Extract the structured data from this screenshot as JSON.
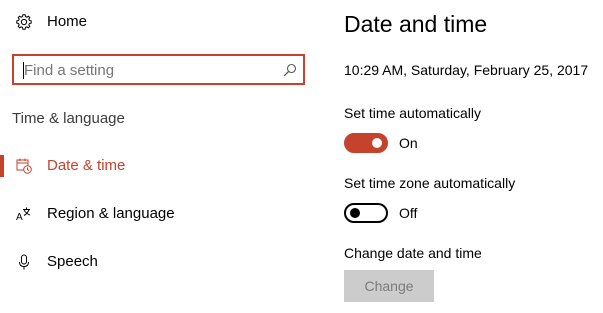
{
  "sidebar": {
    "home": {
      "label": "Home",
      "icon": "gear-icon"
    },
    "search": {
      "placeholder": "Find a setting",
      "value": "",
      "icon": "search-icon"
    },
    "group_title": "Time & language",
    "items": [
      {
        "label": "Date & time",
        "icon": "calendar-clock-icon",
        "active": true
      },
      {
        "label": "Region & language",
        "icon": "region-language-icon",
        "active": false
      },
      {
        "label": "Speech",
        "icon": "microphone-icon",
        "active": false
      }
    ]
  },
  "main": {
    "title": "Date and time",
    "current_datetime": "10:29 AM, Saturday, February 25, 2017",
    "set_time_automatically": {
      "label": "Set time automatically",
      "state": "On",
      "enabled": true
    },
    "set_time_zone_automatically": {
      "label": "Set time zone automatically",
      "state": "Off",
      "enabled": false
    },
    "change_date_time": {
      "label": "Change date and time",
      "button_label": "Change",
      "disabled": true
    }
  },
  "colors": {
    "accent": "#c5422c",
    "disabled_button_bg": "#cccccc",
    "disabled_button_text": "#7a7a7a",
    "secondary_text": "#3c3c3c"
  }
}
